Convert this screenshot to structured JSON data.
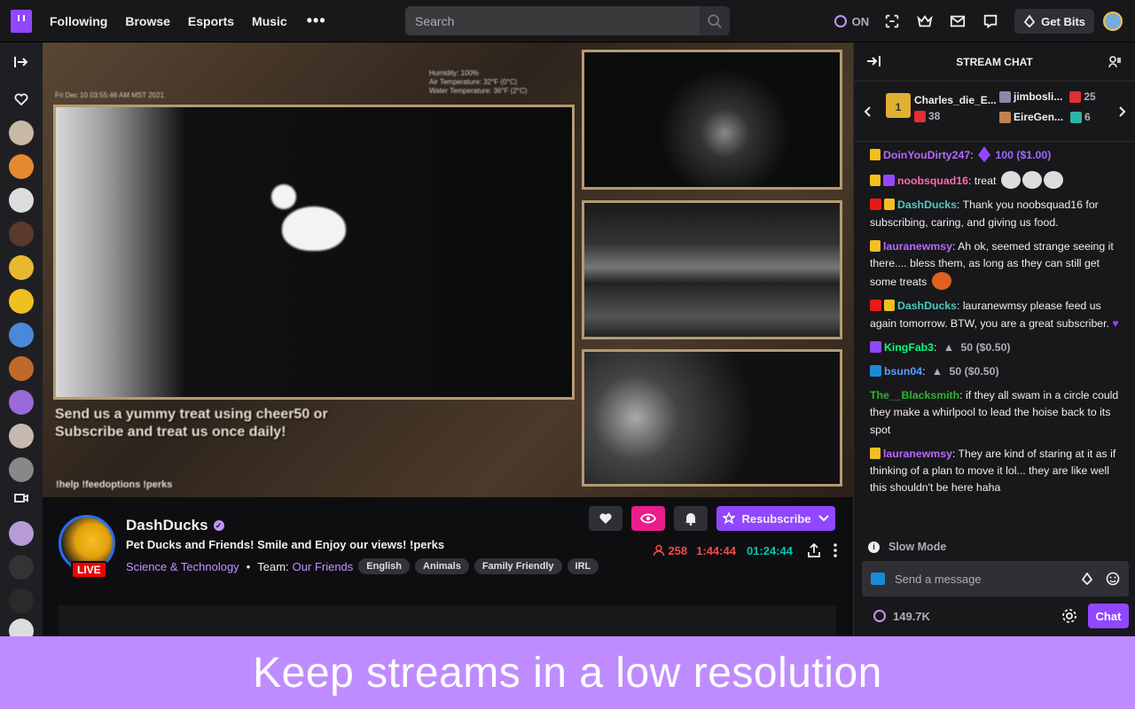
{
  "topnav": {
    "links": [
      "Following",
      "Browse",
      "Esports",
      "Music"
    ],
    "more": "•••",
    "search_placeholder": "Search",
    "points_label": "ON",
    "bits_label": "Get Bits"
  },
  "stream": {
    "overlay_text_1": "Send us a yummy treat using cheer50 or",
    "overlay_text_2": "Subscribe and treat us once daily!",
    "overlay_cmds": "!help !feedoptions !perks",
    "overlay_date": "Fri Dec 10 03:55:46 AM MST 2021",
    "overlay_humidity": "Humidity: 100%",
    "overlay_air": "Air Temperature: 32°F (0°C)",
    "overlay_water": "Water Temperature: 36°F (2°C)"
  },
  "channel": {
    "name": "DashDucks",
    "live_label": "LIVE",
    "title": "Pet Ducks and Friends! Smile and Enjoy our views! !perks",
    "category": "Science & Technology",
    "team_label": "Team:",
    "team_value": "Our Friends",
    "tags": [
      "English",
      "Animals",
      "Family Friendly",
      "IRL"
    ],
    "resub_label": "Resubscribe",
    "viewers": "258",
    "time_red": "1:44:44",
    "uptime": "01:24:44"
  },
  "chat": {
    "header": "STREAM CHAT",
    "gifters": [
      {
        "name": "Charles_die_E...",
        "count": "38"
      },
      {
        "name": "jimbosli...",
        "count": "25"
      },
      {
        "name": "EireGen...",
        "count": "6"
      }
    ],
    "messages": [
      {
        "user": "DoinYouDirty247",
        "color": "#b967ff",
        "text": "100 ($1.00)"
      },
      {
        "user": "noobsquad16",
        "color": "#ff69b4",
        "text": "treat"
      },
      {
        "user": "DashDucks",
        "color": "#4dc9bf",
        "text": "Thank you noobsquad16 for subscribing, caring, and giving us food."
      },
      {
        "user": "lauranewmsy",
        "color": "#b967ff",
        "text": "Ah ok, seemed strange seeing it there.... bless them, as long as they can still get some treats"
      },
      {
        "user": "DashDucks",
        "color": "#4dc9bf",
        "text": "lauranewmsy please feed us again tomorrow. BTW, you are a great subscriber."
      },
      {
        "user": "KingFab3",
        "color": "#00ff7f",
        "text": "50 ($0.50)"
      },
      {
        "user": "bsun04",
        "color": "#5b9cff",
        "text": "50 ($0.50)"
      },
      {
        "user": "The__Blacksmith",
        "color": "#2db52d",
        "text": "if they all swam in a circle could they make a whirlpool to lead the hoise back to its spot"
      },
      {
        "user": "lauranewmsy",
        "color": "#b967ff",
        "text": "They are kind of staring at it as if thinking of a plan to move it lol... they are like well this shouldn't be here haha"
      }
    ],
    "slow_mode": "Slow Mode",
    "input_placeholder": "Send a message",
    "points": "149.7K",
    "chat_button": "Chat"
  },
  "banner": {
    "text": "Keep streams in a low resolution"
  },
  "colors": {
    "brand": "#9147ff",
    "banner": "#bf8cff",
    "live": "#eb0400",
    "uptime": "#00c8af",
    "viewers": "#f4484b"
  }
}
